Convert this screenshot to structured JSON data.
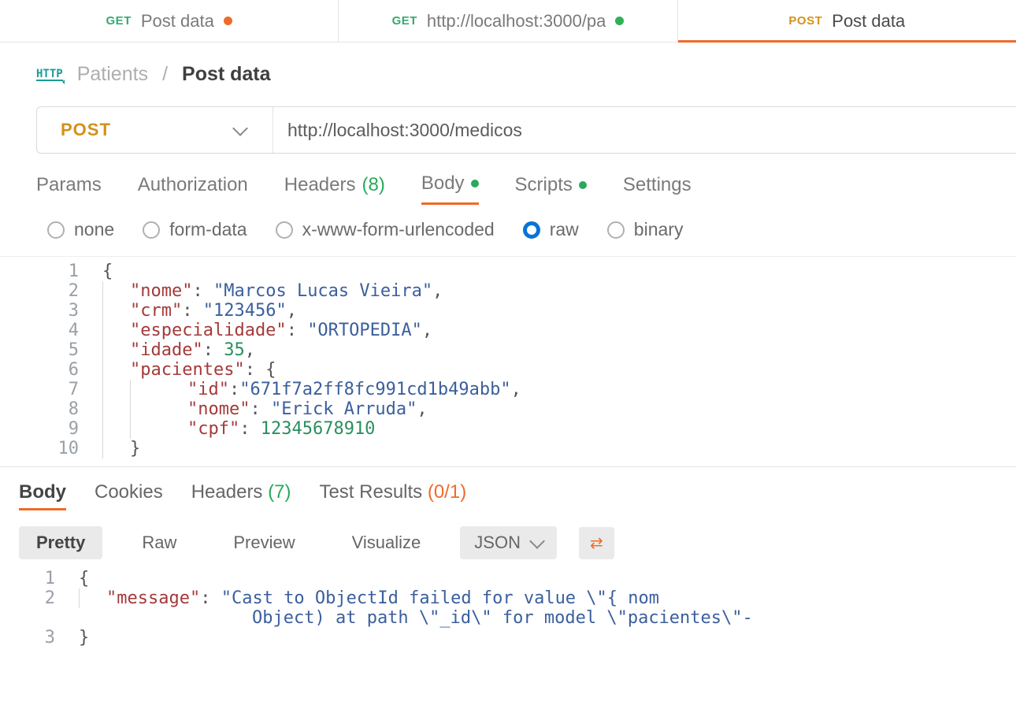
{
  "tabs": [
    {
      "method": "GET",
      "method_class": "tab-method-get",
      "title": "Post data",
      "dot": "orange"
    },
    {
      "method": "GET",
      "method_class": "tab-method-get",
      "title": "http://localhost:3000/pa",
      "dot": "green"
    },
    {
      "method": "POST",
      "method_class": "tab-method-post",
      "title": "Post data",
      "dot": "",
      "active": true
    }
  ],
  "breadcrumb": {
    "collection": "Patients",
    "current": "Post data"
  },
  "request": {
    "method": "POST",
    "url": "http://localhost:3000/medicos"
  },
  "subtabs": {
    "params": "Params",
    "auth": "Authorization",
    "headers_label": "Headers",
    "headers_count": "(8)",
    "body": "Body",
    "scripts": "Scripts",
    "settings": "Settings"
  },
  "body_types": {
    "none": "none",
    "form": "form-data",
    "urlenc": "x-www-form-urlencoded",
    "raw": "raw",
    "binary": "binary"
  },
  "editor_lines": {
    "l1": "{",
    "l2_k": "\"nome\"",
    "l2_v": "\"Marcos Lucas Vieira\"",
    "l3_k": "\"crm\"",
    "l3_v": "\"123456\"",
    "l4_k": "\"especialidade\"",
    "l4_v": "\"ORTOPEDIA\"",
    "l5_k": "\"idade\"",
    "l5_v": "35",
    "l6_k": "\"pacientes\"",
    "l7_k": "\"id\"",
    "l7_v": "\"671f7a2ff8fc991cd1b49abb\"",
    "l8_k": "\"nome\"",
    "l8_v": "\"Erick Arruda\"",
    "l9_k": "\"cpf\"",
    "l9_v": "12345678910",
    "l10": "}"
  },
  "response": {
    "tabs": {
      "body": "Body",
      "cookies": "Cookies",
      "headers_label": "Headers",
      "headers_count": "(7)",
      "test_label": "Test Results",
      "test_count": "(0/1)"
    },
    "views": {
      "pretty": "Pretty",
      "raw": "Raw",
      "preview": "Preview",
      "visualize": "Visualize",
      "format": "JSON"
    },
    "lines": {
      "l1": "{",
      "l2_k": "\"message\"",
      "l2_v1": "\"Cast to ObjectId failed for value \\\"{ nom",
      "l2_v2": "Object) at path \\\"_id\\\" for model \\\"pacientes\\\"-",
      "l3": "}"
    }
  }
}
